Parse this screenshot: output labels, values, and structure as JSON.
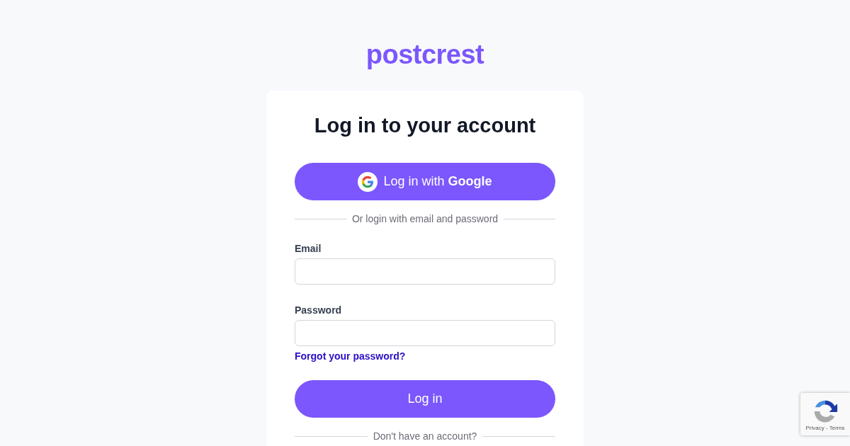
{
  "logo": "postcrest",
  "title": "Log in to your account",
  "google_button": "Log in with **Google**",
  "divider": "Or login with email and password",
  "fields": [
    {
      "label": "Email"
    },
    {
      "label": "Password"
    }
  ],
  "forgot_link": "Forgot your password?",
  "login_button": "Log in",
  "signup_divider": "Don't have an account?",
  "recaptcha": {
    "links": "Privacy - Terms"
  }
}
